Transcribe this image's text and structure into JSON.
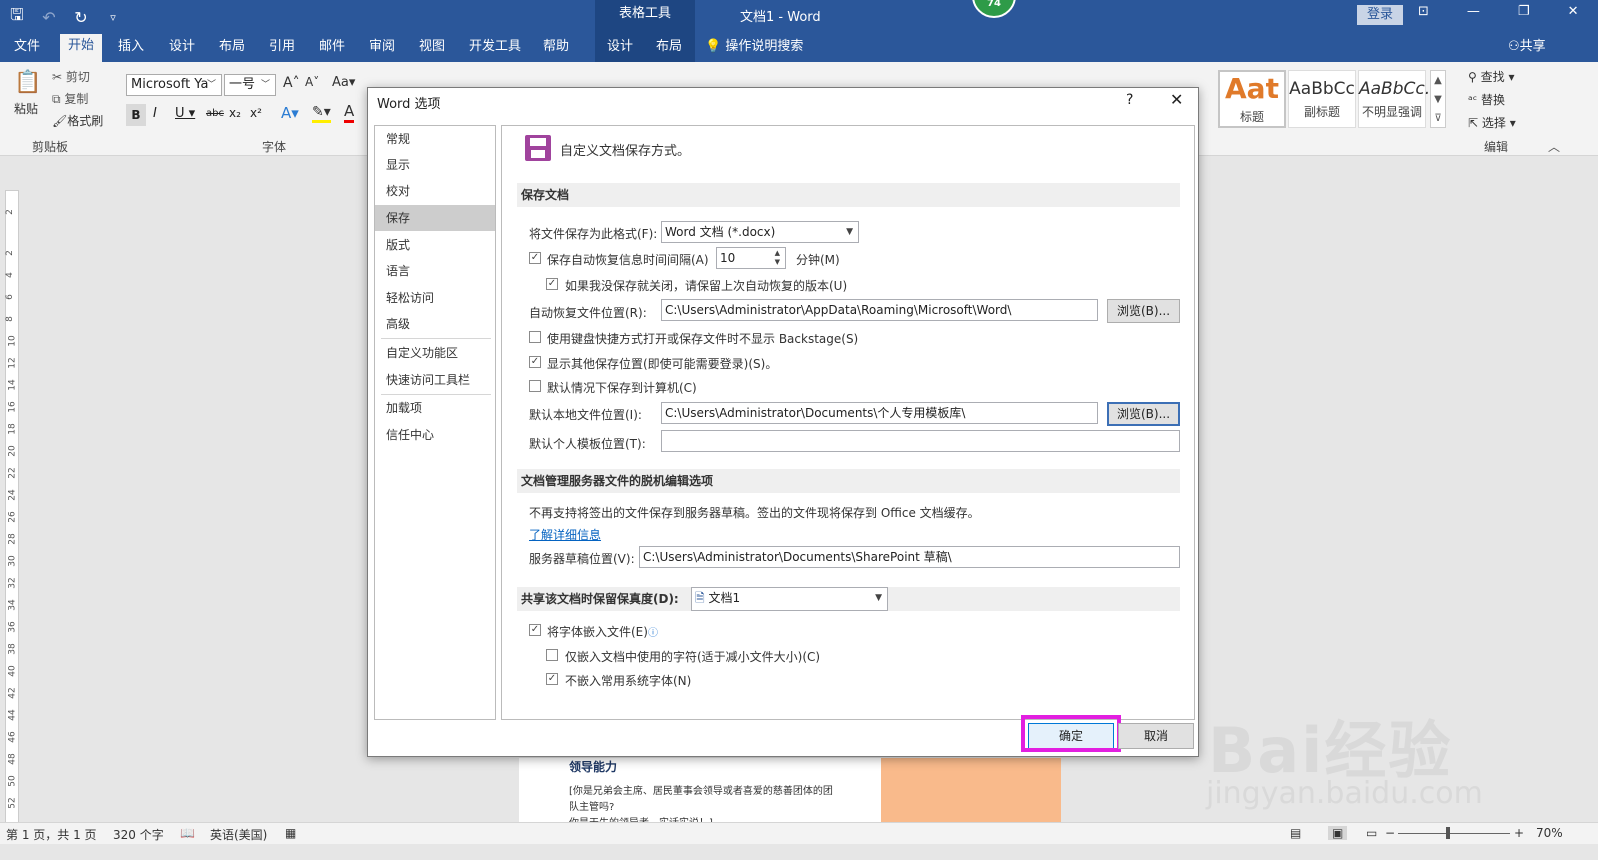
{
  "titlebar": {
    "contextual": "表格工具",
    "doc_title": "文档1 - Word",
    "badge": "74",
    "login": "登录",
    "qat": [
      "save-icon",
      "undo-icon",
      "redo-icon",
      "customize-icon"
    ]
  },
  "tabs": [
    "文件",
    "开始",
    "插入",
    "设计",
    "布局",
    "引用",
    "邮件",
    "审阅",
    "视图",
    "开发工具",
    "帮助",
    "设计",
    "布局",
    "操作说明搜索"
  ],
  "tabs_extra": {
    "share": "共享"
  },
  "ribbon": {
    "paste": "粘贴",
    "cut": "剪切",
    "copy": "复制",
    "format_painter": "格式刷",
    "clipboard": "剪贴板",
    "font_name": "Microsoft Ya",
    "font_size": "一号",
    "font_group": "字体",
    "styles": [
      {
        "preview": "Aat",
        "name": "标题"
      },
      {
        "preview": "AaBbCc",
        "name": "副标题"
      },
      {
        "preview": "AaBbCc.",
        "name": "不明显强调"
      }
    ],
    "find": "查找",
    "replace": "替换",
    "select": "选择",
    "edit_group": "编辑"
  },
  "dialog": {
    "title": "Word 选项",
    "help": "?",
    "nav": [
      "常规",
      "显示",
      "校对",
      "保存",
      "版式",
      "语言",
      "轻松访问",
      "高级",
      "自定义功能区",
      "快速访问工具栏",
      "加载项",
      "信任中心"
    ],
    "header": "自定义文档保存方式。",
    "sec_save": "保存文档",
    "format_label": "将文件保存为此格式(F):",
    "format_value": "Word 文档 (*.docx)",
    "autorecover_label": "保存自动恢复信息时间间隔(A)",
    "autorecover_value": "10",
    "minutes": "分钟(M)",
    "keep_last": "如果我没保存就关闭，请保留上次自动恢复的版本(U)",
    "ar_location_label": "自动恢复文件位置(R):",
    "ar_location_value": "C:\\Users\\Administrator\\AppData\\Roaming\\Microsoft\\Word\\",
    "browse1": "浏览(B)...",
    "no_backstage": "使用键盘快捷方式打开或保存文件时不显示 Backstage(S)",
    "show_other": "显示其他保存位置(即使可能需要登录)(S)。",
    "default_computer": "默认情况下保存到计算机(C)",
    "local_location_label": "默认本地文件位置(I):",
    "local_location_value": "C:\\Users\\Administrator\\Documents\\个人专用模板库\\",
    "browse2": "浏览(B)...",
    "template_label": "默认个人模板位置(T):",
    "template_value": "",
    "sec_offline": "文档管理服务器文件的脱机编辑选项",
    "offline_text": "不再支持将签出的文件保存到服务器草稿。签出的文件现将保存到 Office 文档缓存。",
    "learn_more": "了解详细信息",
    "drafts_label": "服务器草稿位置(V):",
    "drafts_value": "C:\\Users\\Administrator\\Documents\\SharePoint 草稿\\",
    "sec_fidelity": "共享该文档时保留保真度(D):",
    "fidelity_doc": "文档1",
    "embed_fonts": "将字体嵌入文件(E)",
    "embed_used": "仅嵌入文档中使用的字符(适于减小文件大小)(C)",
    "no_common": "不嵌入常用系统字体(N)",
    "ok": "确定",
    "cancel": "取消"
  },
  "document": {
    "heading": "领导能力",
    "lines": [
      "[你是兄弟会主席、居民董事会领导或者喜爱的慈善团体的团",
      "队主管吗?",
      "你是天生的领导者，实话实说！]"
    ]
  },
  "ruler_numbers": [
    "2",
    "2",
    "4",
    "6",
    "8",
    "10",
    "12",
    "14",
    "16",
    "18",
    "20",
    "22",
    "24",
    "26",
    "28",
    "30",
    "32",
    "34",
    "36",
    "38",
    "40",
    "42",
    "44",
    "46",
    "48",
    "50",
    "52"
  ],
  "status": {
    "page": "第 1 页，共 1 页",
    "words": "320 个字",
    "lang": "英语(美国)",
    "zoom": "70%"
  },
  "watermark": {
    "big": "Bai经验",
    "small": "jingyan.baidu.com"
  }
}
